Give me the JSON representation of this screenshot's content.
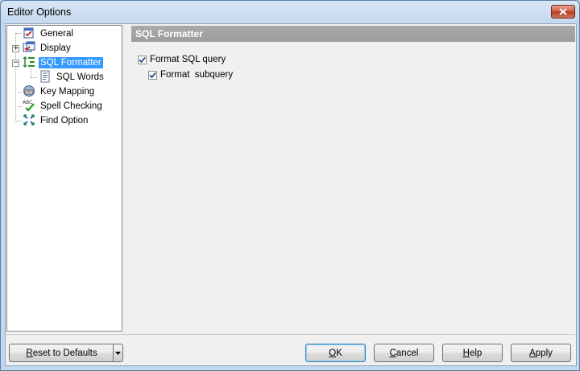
{
  "window": {
    "title": "Editor Options"
  },
  "tree": {
    "items": [
      {
        "label": "General",
        "icon": "general-icon"
      },
      {
        "label": "Display",
        "icon": "display-icon"
      },
      {
        "label": "SQL Formatter",
        "icon": "sql-formatter-icon"
      },
      {
        "label": "SQL Words",
        "icon": "document-icon"
      },
      {
        "label": "Key Mapping",
        "icon": "keyboard-icon"
      },
      {
        "label": "Spell Checking",
        "icon": "spell-check-icon"
      },
      {
        "label": "Find Option",
        "icon": "find-icon"
      }
    ],
    "selected": "SQL Formatter"
  },
  "page": {
    "header": "SQL Formatter",
    "format_sql_query": {
      "label": "Format SQL query",
      "checked": true
    },
    "format_subquery": {
      "label": "Format  subquery",
      "checked": true
    }
  },
  "buttons": {
    "reset_first": "R",
    "reset_rest": "eset to Defaults",
    "ok_first": "O",
    "ok_rest": "K",
    "cancel_first": "C",
    "cancel_rest": "ancel",
    "help_first": "H",
    "help_rest": "elp",
    "apply_first": "A",
    "apply_rest": "pply"
  },
  "colors": {
    "selection": "#3399ff",
    "header_bg": "#a9a9a9"
  }
}
